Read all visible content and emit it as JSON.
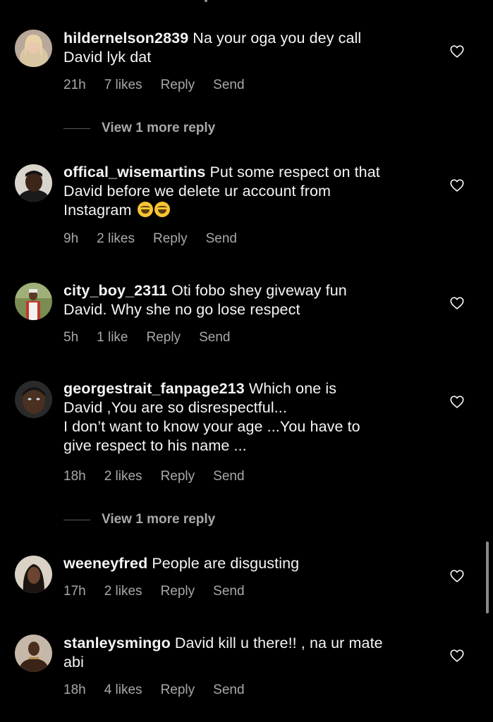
{
  "comments": [
    {
      "username": "hildernelson2839",
      "lines": [
        "Na your oga you dey call",
        "David lyk dat"
      ],
      "time": "21h",
      "likes": "7 likes",
      "reply": "Reply",
      "send": "Send"
    },
    {
      "username": "offical_wisemartins",
      "lines": [
        "Put some respect on that",
        "David before we delete ur account from",
        "Instagram"
      ],
      "emoji": "face-with-tears-of-joy-icon",
      "time": "9h",
      "likes": "2 likes",
      "reply": "Reply",
      "send": "Send"
    },
    {
      "username": "city_boy_2311",
      "lines": [
        "Oti fobo shey giveway fun",
        "David.  Why she no go lose respect"
      ],
      "time": "5h",
      "likes": "1 like",
      "reply": "Reply",
      "send": "Send"
    },
    {
      "username": "georgestrait_fanpage213",
      "lines": [
        "Which one is",
        "David ,You are so disrespectful...",
        "I don’t want to know your age ...You have to",
        "give respect to his name ..."
      ],
      "time": "18h",
      "likes": "2 likes",
      "reply": "Reply",
      "send": "Send"
    },
    {
      "username": "weeneyfred",
      "lines": [
        "People are disgusting"
      ],
      "time": "17h",
      "likes": "2 likes",
      "reply": "Reply",
      "send": "Send"
    },
    {
      "username": "stanleysmingo",
      "lines": [
        "David kill u there!! , na ur mate",
        "abi"
      ],
      "time": "18h",
      "likes": "4 likes",
      "reply": "Reply",
      "send": "Send"
    }
  ],
  "view_more": [
    "View 1 more reply",
    "View 1 more reply"
  ],
  "colors": {
    "background": "#000000",
    "text": "#f5f5f5",
    "secondary": "#a8a8a8"
  }
}
